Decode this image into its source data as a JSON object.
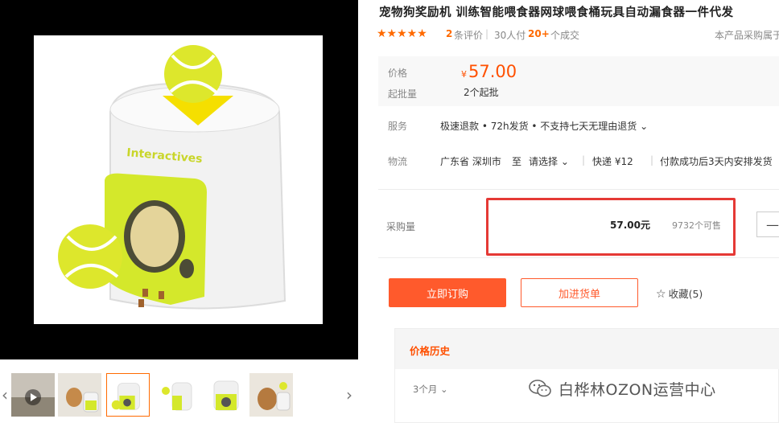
{
  "gallery": {
    "main_image": "pet-ball-launcher-photo",
    "thumbnails": [
      {
        "name": "video-thumbnail",
        "has_play": true
      },
      {
        "name": "dog-with-feeder-thumbnail"
      },
      {
        "name": "ball-feeder-thumbnail",
        "active": true
      },
      {
        "name": "feeder-side-thumbnail"
      },
      {
        "name": "feeder-front-thumbnail"
      },
      {
        "name": "dog-photo-thumbnail"
      }
    ],
    "brand_text": "Interactives"
  },
  "product": {
    "title": "宠物狗奖励机 训练智能喂食器网球喂食桶玩具自动漏食器一件代发",
    "stars": "★★★★★",
    "review_count": "2",
    "review_label": "条评价",
    "buyers": "30人付",
    "deals_count": "20+",
    "deals_label": "个成交",
    "from_label": "本产品采购属于"
  },
  "price": {
    "label": "价格",
    "currency": "¥",
    "value": "57.00",
    "min_label": "起批量",
    "min_value": "2个起批"
  },
  "service": {
    "label": "服务",
    "text": "极速退款 • 72h发货 • 不支持七天无理由退货 ⌄"
  },
  "logistics": {
    "label": "物流",
    "from": "广东省 深圳市",
    "to_label": "至",
    "to_select": "请选择 ⌄",
    "express": "快递 ¥12",
    "shipping_note": "付款成功后3天内安排发货"
  },
  "quantity": {
    "label": "采购量",
    "unit_price": "57.00元",
    "stock": "9732个可售",
    "minus": "—"
  },
  "actions": {
    "buy_now": "立即订购",
    "add_cart": "加进货单",
    "favorite": "收藏(5)"
  },
  "history": {
    "title": "价格历史",
    "range": "3个月 ⌄"
  },
  "watermark": {
    "text": "白桦林OZON运营中心",
    "icon": "wechat-icon"
  },
  "colors": {
    "accent": "#ff5000",
    "button": "#ff5a2c",
    "highlight": "#e53935",
    "ball": "#d4e82b"
  }
}
